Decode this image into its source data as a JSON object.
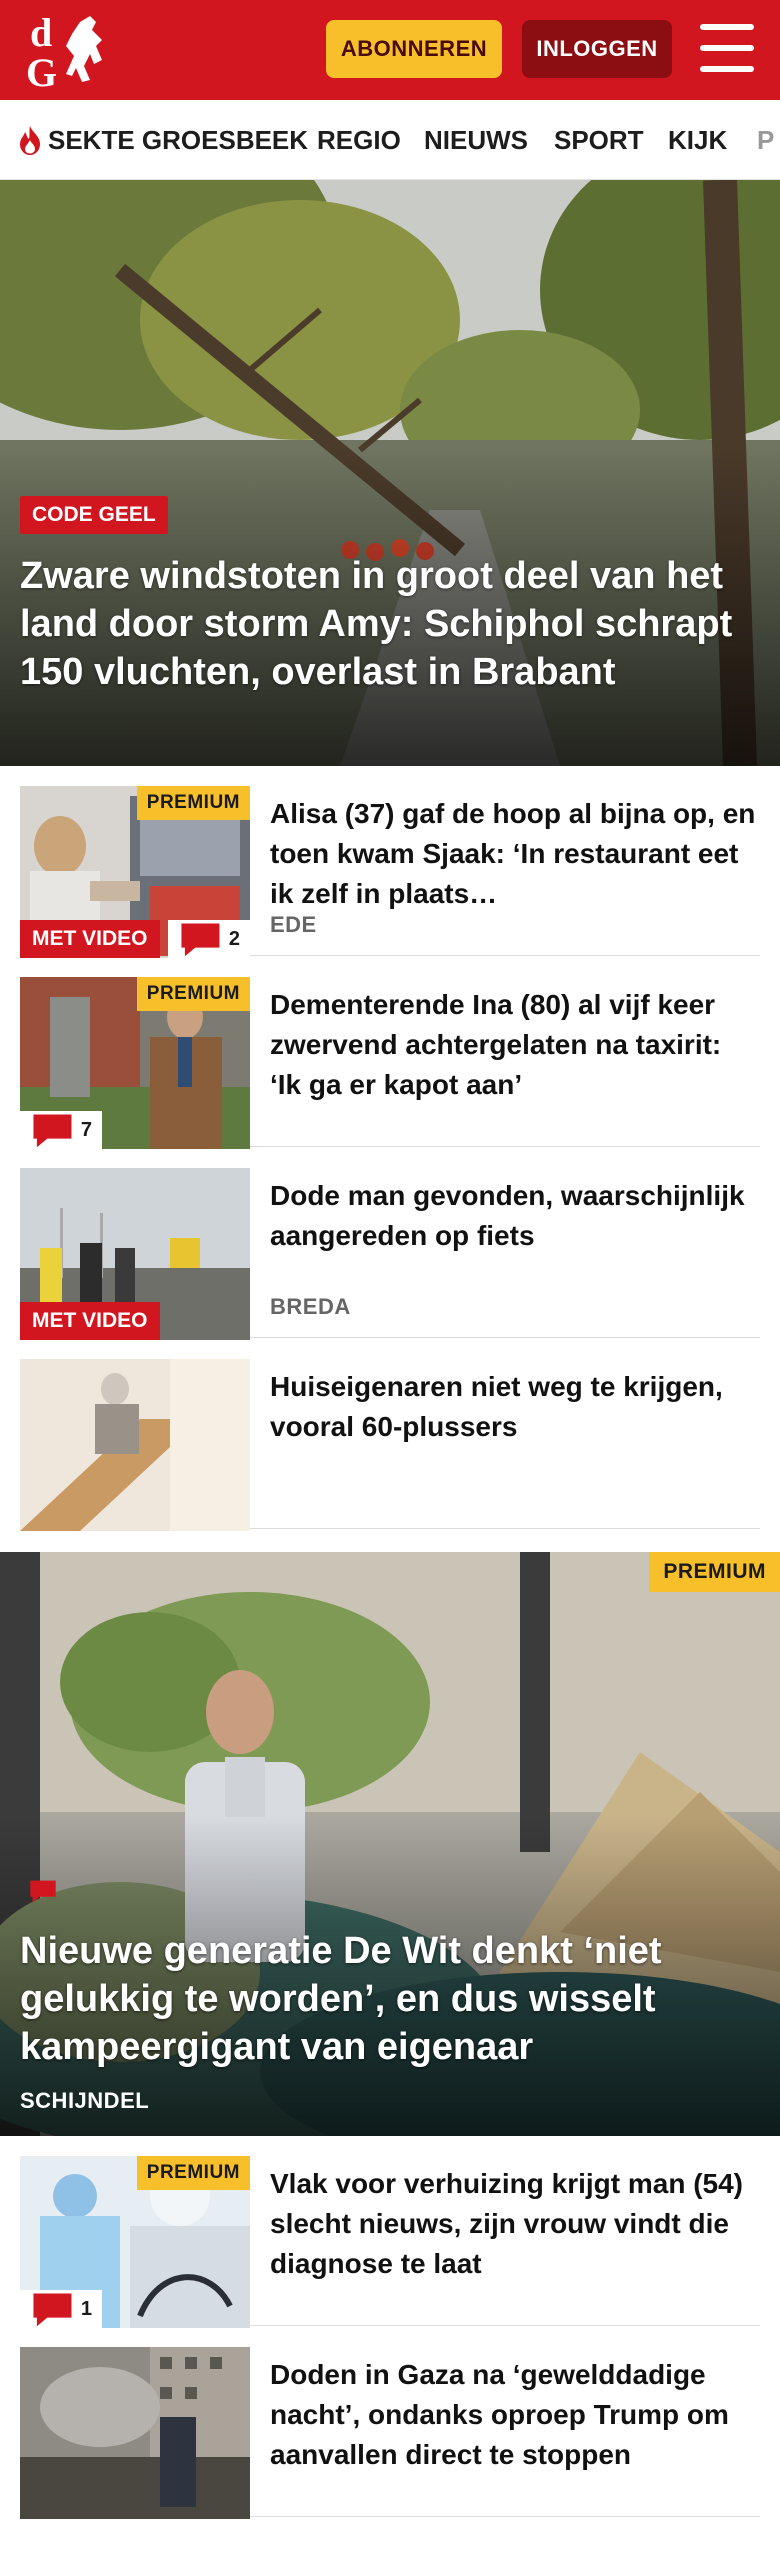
{
  "header": {
    "subscribe_label": "ABONNEREN",
    "login_label": "INLOGGEN",
    "brand_color": "#d2161f"
  },
  "nav": {
    "items": [
      "SEKTE GROESBEEK",
      "REGIO",
      "NIEUWS",
      "SPORT",
      "KIJK",
      "P"
    ],
    "trending_icon": "flame-icon"
  },
  "hero": {
    "label": "CODE GEEL",
    "title": "Zware windstoten in groot deel van het land door storm Amy: Schiphol schrapt 150 vluchten, overlast in Brabant"
  },
  "articles": [
    {
      "premium": "PREMIUM",
      "title": "Alisa (37) gaf de hoop al bijna op, en toen kwam Sjaak: ‘In restaurant eet ik zelf in plaats…",
      "location": "EDE",
      "video": "MET VIDEO",
      "comments": "2"
    },
    {
      "premium": "PREMIUM",
      "title": "Dementerende Ina (80) al vijf keer zwervend achtergelaten na taxirit: ‘Ik ga er kapot aan’",
      "comments": "7"
    },
    {
      "title": "Dode man gevonden, waarschijn­lijk aangereden op fiets",
      "location": "BREDA",
      "video": "MET VIDEO"
    },
    {
      "title": "Huiseigenaren niet weg te krijgen, vooral 60-plussers"
    }
  ],
  "feature": {
    "premium": "PREMIUM",
    "title": "Nieuwe generatie De Wit denkt ‘niet gelukkig te worden’, en dus wisselt kampeergigant van eigenaar",
    "location": "SCHIJNDEL"
  },
  "articles2": [
    {
      "premium": "PREMIUM",
      "title": "Vlak voor verhuizing krijgt man (54) slecht nieuws, zijn vrouw vindt die diagnose te laat",
      "comments": "1"
    },
    {
      "title": "Doden in Gaza na ‘gewelddadige nacht’, ondanks oproep Trump om aanvallen direct te stoppen"
    }
  ]
}
